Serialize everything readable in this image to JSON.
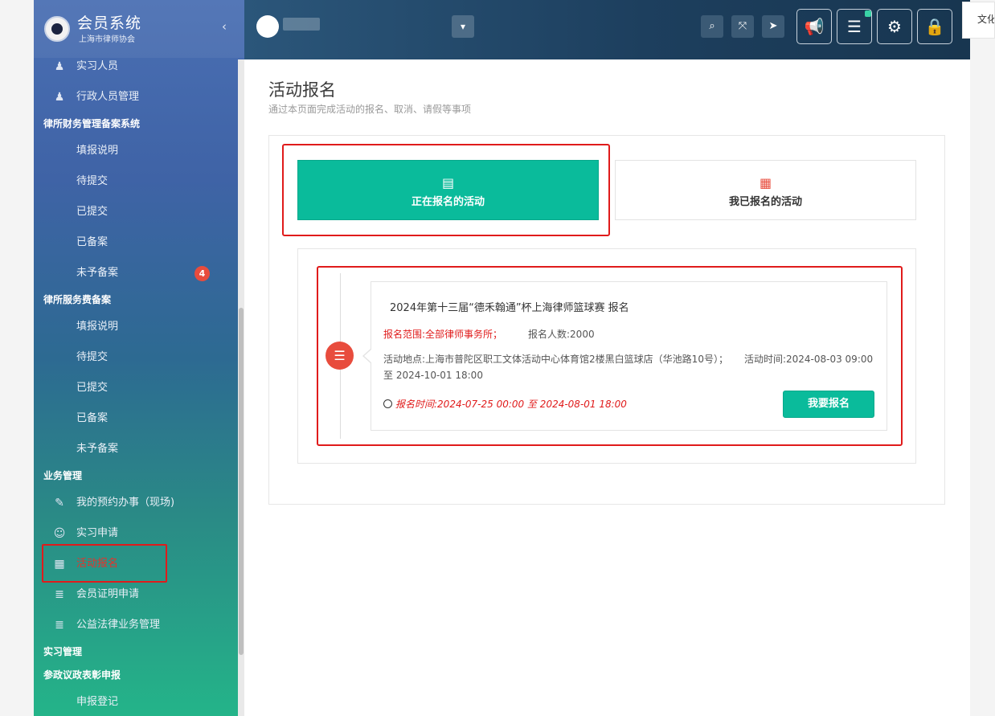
{
  "brand": {
    "title": "会员系统",
    "subtitle": "上海市律师协会",
    "collapse_icon": "‹"
  },
  "sidebar": {
    "items": [
      {
        "type": "item",
        "label": "实习人员",
        "icon": "person-icon"
      },
      {
        "type": "item",
        "label": "行政人员管理",
        "icon": "person-icon"
      },
      {
        "type": "section",
        "label": "律所财务管理备案系统"
      },
      {
        "type": "item",
        "label": "填报说明"
      },
      {
        "type": "item",
        "label": "待提交"
      },
      {
        "type": "item",
        "label": "已提交"
      },
      {
        "type": "item",
        "label": "已备案"
      },
      {
        "type": "item",
        "label": "未予备案",
        "badge": "4"
      },
      {
        "type": "section",
        "label": "律所服务费备案"
      },
      {
        "type": "item",
        "label": "填报说明"
      },
      {
        "type": "item",
        "label": "待提交"
      },
      {
        "type": "item",
        "label": "已提交"
      },
      {
        "type": "item",
        "label": "已备案"
      },
      {
        "type": "item",
        "label": "未予备案"
      },
      {
        "type": "section",
        "label": "业务管理"
      },
      {
        "type": "item",
        "label": "我的预约办事（现场)",
        "icon": "edit-icon"
      },
      {
        "type": "item",
        "label": "实习申请",
        "icon": "users-icon"
      },
      {
        "type": "item",
        "label": "活动报名",
        "icon": "calendar-icon",
        "active": true
      },
      {
        "type": "item",
        "label": "会员证明申请",
        "icon": "database-icon"
      },
      {
        "type": "item",
        "label": "公益法律业务管理",
        "icon": "database-icon"
      },
      {
        "type": "section",
        "label": "实习管理"
      },
      {
        "type": "section",
        "label": "参政议政表彰申报"
      },
      {
        "type": "item",
        "label": "申报登记"
      }
    ]
  },
  "topbar": {
    "dropdown_icon": "chevron-down-icon"
  },
  "popup": {
    "text": "文化"
  },
  "page": {
    "title": "活动报名",
    "subtitle": "通过本页面完成活动的报名、取消、请假等事项"
  },
  "tabs": {
    "open_label": "正在报名的活动",
    "mine_label": "我已报名的活动"
  },
  "event": {
    "title": "2024年第十三届“德禾翰通”杯上海律师篮球赛 报名",
    "scope": "报名范围:全部律师事务所；",
    "count": "报名人数:2000",
    "location": "活动地点:上海市普陀区职工文体活动中心体育馆2楼黑白篮球店（华池路10号）；",
    "time": "活动时间:2024-08-03 09:00 至 2024-10-01 18:00",
    "reg_time": "报名时间:2024-07-25 00:00 至 2024-08-01 18:00",
    "signup_label": "我要报名"
  },
  "colors": {
    "accent": "#0abb9b",
    "danger": "#e84c3d",
    "highlight_box": "#e01b1b"
  }
}
